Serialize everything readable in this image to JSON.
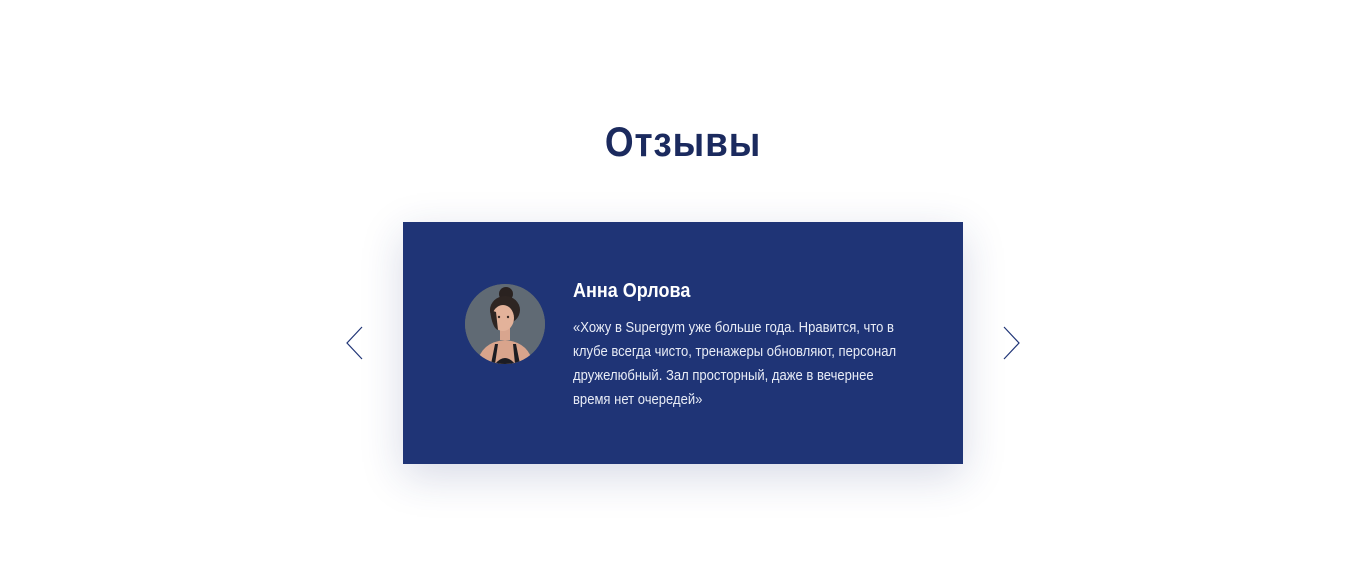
{
  "section": {
    "title": "Отзывы"
  },
  "slider": {
    "prev_icon": "chevron-left-icon",
    "next_icon": "chevron-right-icon"
  },
  "review": {
    "name": "Анна Орлова",
    "text": "«Хожу в Supergym уже больше года. Нравится, что в клубе всегда чисто, тренажеры обновляют, персонал дружелюбный. Зал просторный, даже в вечернее время нет очередей»"
  },
  "colors": {
    "title": "#1b2a5e",
    "card_background": "#1f3476",
    "arrow": "#1f3476",
    "card_text": "#ffffff"
  }
}
